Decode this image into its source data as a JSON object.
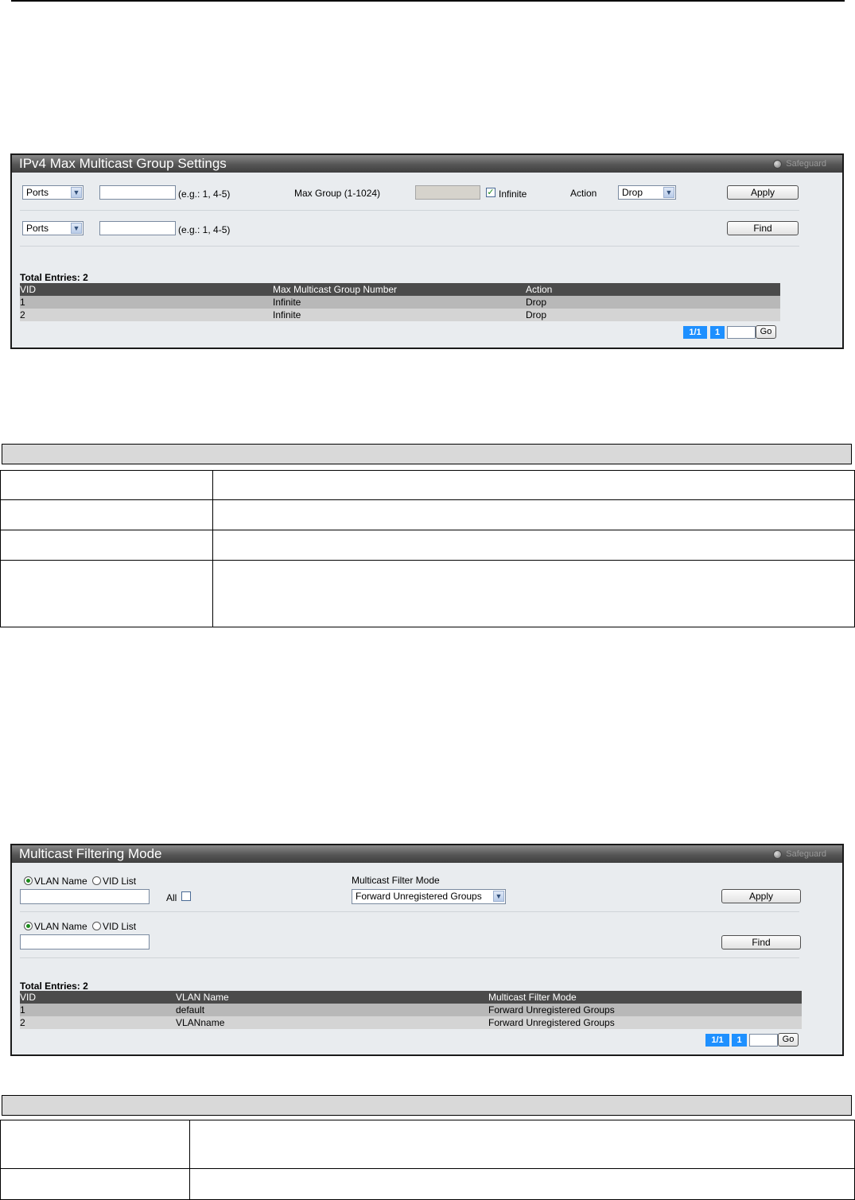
{
  "panel1": {
    "title": "IPv4 Max Multicast Group Settings",
    "safeguard": "Safeguard",
    "form1": {
      "type_select": "Ports",
      "ports_placeholder_hint": "(e.g.: 1, 4-5)",
      "max_group_label": "Max Group (1-1024)",
      "infinite_label": "Infinite",
      "infinite_checked": true,
      "action_label": "Action",
      "action_select": "Drop",
      "apply": "Apply"
    },
    "form2": {
      "type_select": "Ports",
      "hint": "(e.g.: 1, 4-5)",
      "find": "Find"
    },
    "total_entries": "Total Entries: 2",
    "columns": [
      "VID",
      "Max Multicast Group Number",
      "Action"
    ],
    "rows": [
      [
        "1",
        "Infinite",
        "Drop"
      ],
      [
        "2",
        "Infinite",
        "Drop"
      ]
    ],
    "pager": {
      "page_of": "1/1",
      "page": "1",
      "go": "Go"
    }
  },
  "panel2": {
    "title": "Multicast Filtering Mode",
    "safeguard": "Safeguard",
    "form1": {
      "radio_vlan_name": "VLAN Name",
      "radio_vid_list": "VID List",
      "all_label": "All",
      "filter_mode_label": "Multicast Filter Mode",
      "filter_mode_select": "Forward Unregistered Groups",
      "apply": "Apply"
    },
    "form2": {
      "radio_vlan_name": "VLAN Name",
      "radio_vid_list": "VID List",
      "find": "Find"
    },
    "total_entries": "Total Entries: 2",
    "columns": [
      "VID",
      "VLAN Name",
      "Multicast Filter Mode"
    ],
    "rows": [
      [
        "1",
        "default",
        "Forward Unregistered Groups"
      ],
      [
        "2",
        "VLANname",
        "Forward Unregistered Groups"
      ]
    ],
    "pager": {
      "page_of": "1/1",
      "page": "1",
      "go": "Go"
    }
  }
}
